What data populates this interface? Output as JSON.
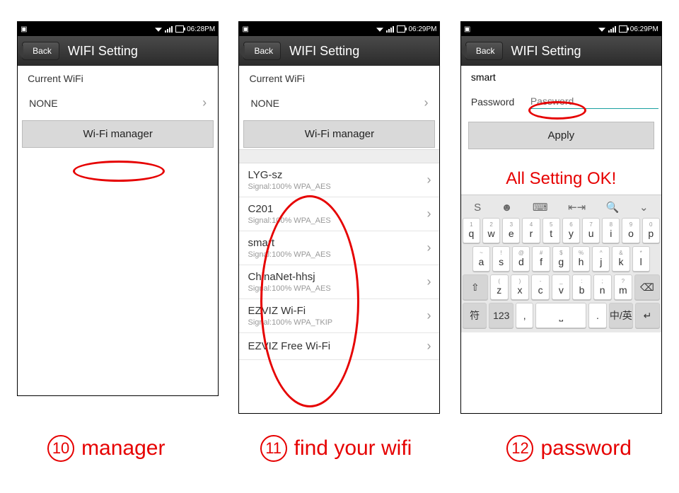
{
  "status": {
    "time1": "06:28PM",
    "time2": "06:29PM",
    "time3": "06:29PM"
  },
  "header": {
    "back": "Back",
    "title": "WIFI Setting"
  },
  "screen1": {
    "current_label": "Current WiFi",
    "current_value": "NONE",
    "manager_btn": "Wi-Fi manager"
  },
  "screen2": {
    "current_label": "Current WiFi",
    "current_value": "NONE",
    "manager_btn": "Wi-Fi manager",
    "networks": [
      {
        "name": "LYG-sz",
        "sub": "Signal:100%   WPA_AES"
      },
      {
        "name": "C201",
        "sub": "Signal:100%   WPA_AES"
      },
      {
        "name": "smart",
        "sub": "Signal:100%   WPA_AES"
      },
      {
        "name": "ChinaNet-hhsj",
        "sub": "Signal:100%   WPA_AES"
      },
      {
        "name": "EZVIZ Wi-Fi",
        "sub": "Signal:100%   WPA_TKIP"
      },
      {
        "name": "EZVIZ Free Wi-Fi",
        "sub": ""
      }
    ]
  },
  "screen3": {
    "ssid": "smart",
    "pw_label": "Password",
    "pw_placeholder": "Password",
    "apply_btn": "Apply",
    "ok_msg": "All Setting OK!"
  },
  "keyboard": {
    "row1": [
      "q",
      "w",
      "e",
      "r",
      "t",
      "y",
      "u",
      "i",
      "o",
      "p"
    ],
    "row1_mini": [
      "1",
      "2",
      "3",
      "4",
      "5",
      "6",
      "7",
      "8",
      "9",
      "0"
    ],
    "row2": [
      "a",
      "s",
      "d",
      "f",
      "g",
      "h",
      "j",
      "k",
      "l"
    ],
    "row2_mini": [
      "~",
      "!",
      "@",
      "#",
      "$",
      "%",
      "^",
      "&",
      "*"
    ],
    "row3": [
      "z",
      "x",
      "c",
      "v",
      "b",
      "n",
      "m"
    ],
    "row3_mini": [
      "(",
      ")",
      "-",
      "_",
      ":",
      ";",
      "?"
    ],
    "shift": "⇧",
    "bksp": "⌫",
    "sym": "符",
    "num": "123",
    "comma": ",",
    "space": "",
    "period": ".",
    "lang": "中/英",
    "enter": "↵"
  },
  "captions": {
    "c1_num": "10",
    "c1_text": "manager",
    "c2_num": "11",
    "c2_text": "find  your wifi",
    "c3_num": "12",
    "c3_text": "password"
  }
}
